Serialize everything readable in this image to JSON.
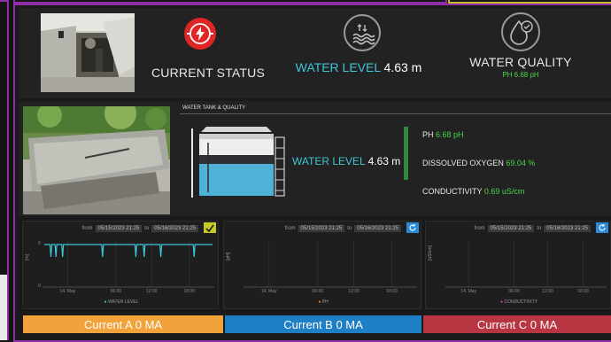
{
  "status": {
    "current_status": "CURRENT STATUS",
    "water_level_label": "WATER LEVEL",
    "water_level_value": "4.63 m",
    "water_quality_label": "WATER QUALITY",
    "water_quality_sub": "PH 6.68 pH"
  },
  "tank": {
    "section_title": "WATER TANK & QUALITY",
    "water_level_label": "WATER LEVEL",
    "water_level_value": "4.63 m",
    "fill_fraction": 0.58,
    "ph_label": "PH",
    "ph_value": "6.68 pH",
    "do_label": "DISSOLVED OXYGEN",
    "do_value": "69.04 %",
    "cond_label": "CONDUCTIVITY",
    "cond_value": "0.69 uS/cm"
  },
  "charts": [
    {
      "from_label": "from",
      "from_date": "05/15/2023 21:25",
      "to_label": "to",
      "to_date": "05/16/2023 21:25",
      "y_axis": "[m]",
      "y_ticks": [
        "5",
        "0"
      ],
      "x_ticks": [
        "14. May",
        "06:00",
        "12:00",
        "18:00"
      ],
      "legend": "WATER LEVEL",
      "legend_color": "#3fc6d8",
      "button_color": "#c7c92b"
    },
    {
      "from_label": "from",
      "from_date": "05/15/2023 21:25",
      "to_label": "to",
      "to_date": "05/16/2023 21:25",
      "y_axis": "[pH]",
      "x_ticks": [
        "14. May",
        "06:00",
        "12:00",
        "18:00"
      ],
      "legend": "PH",
      "legend_color": "#ff7f2a",
      "button_color": "#2a8ad8"
    },
    {
      "from_label": "from",
      "from_date": "05/15/2023 21:25",
      "to_label": "to",
      "to_date": "05/16/2023 21:25",
      "y_axis": "[uS/cm]",
      "x_ticks": [
        "14. May",
        "06:00",
        "12:00",
        "18:00"
      ],
      "legend": "CONDUCTIVITY",
      "legend_color": "#d63dd6",
      "button_color": "#2a8ad8"
    }
  ],
  "currents": [
    {
      "label": "Current A 0 MA",
      "color": "#f2a23a"
    },
    {
      "label": "Current B 0 MA",
      "color": "#1f7fc4"
    },
    {
      "label": "Current C 0 MA",
      "color": "#b83542"
    }
  ],
  "colors": {
    "accent_cyan": "#3fc6d8",
    "accent_green": "#46d64a",
    "alert_red": "#e02525",
    "frame_purple": "#8e2fa8",
    "frame_yellow": "#c9bf2a"
  }
}
